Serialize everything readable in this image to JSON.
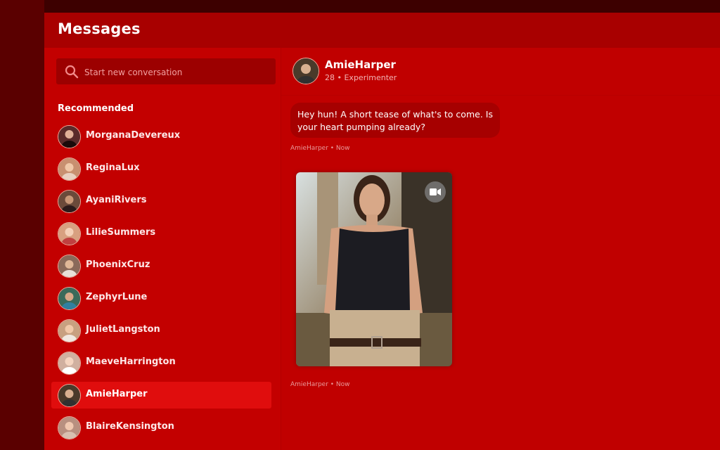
{
  "header": {
    "title": "Messages"
  },
  "search": {
    "placeholder": "Start new conversation"
  },
  "sidebar": {
    "section_title": "Recommended",
    "items": [
      {
        "name": "MorganaDevereux",
        "avatar_color": "#5a2a2a"
      },
      {
        "name": "ReginaLux",
        "avatar_color": "#c89070"
      },
      {
        "name": "AyaniRivers",
        "avatar_color": "#6b4a3a"
      },
      {
        "name": "LilieSummers",
        "avatar_color": "#d8a080"
      },
      {
        "name": "PhoenixCruz",
        "avatar_color": "#8a6a5a"
      },
      {
        "name": "ZephyrLune",
        "avatar_color": "#3a6a5a"
      },
      {
        "name": "JulietLangston",
        "avatar_color": "#c8a080"
      },
      {
        "name": "MaeveHarrington",
        "avatar_color": "#d0b0a0"
      },
      {
        "name": "AmieHarper",
        "avatar_color": "#4a3a2a",
        "active": true
      },
      {
        "name": "BlaireKensington",
        "avatar_color": "#b89080"
      }
    ]
  },
  "chat": {
    "contact_name": "AmieHarper",
    "contact_sub": "28 • Experimenter",
    "messages": [
      {
        "text": "Hey hun! A short tease of what's to come. Is your heart pumping already?",
        "meta": "AmieHarper • Now"
      },
      {
        "type": "video",
        "icon": "video-camera-icon",
        "meta": "AmieHarper • Now"
      }
    ]
  },
  "colors": {
    "panel": "#c00000",
    "header": "#a80000",
    "active_item": "#e00d0d",
    "bubble": "#a60000"
  }
}
